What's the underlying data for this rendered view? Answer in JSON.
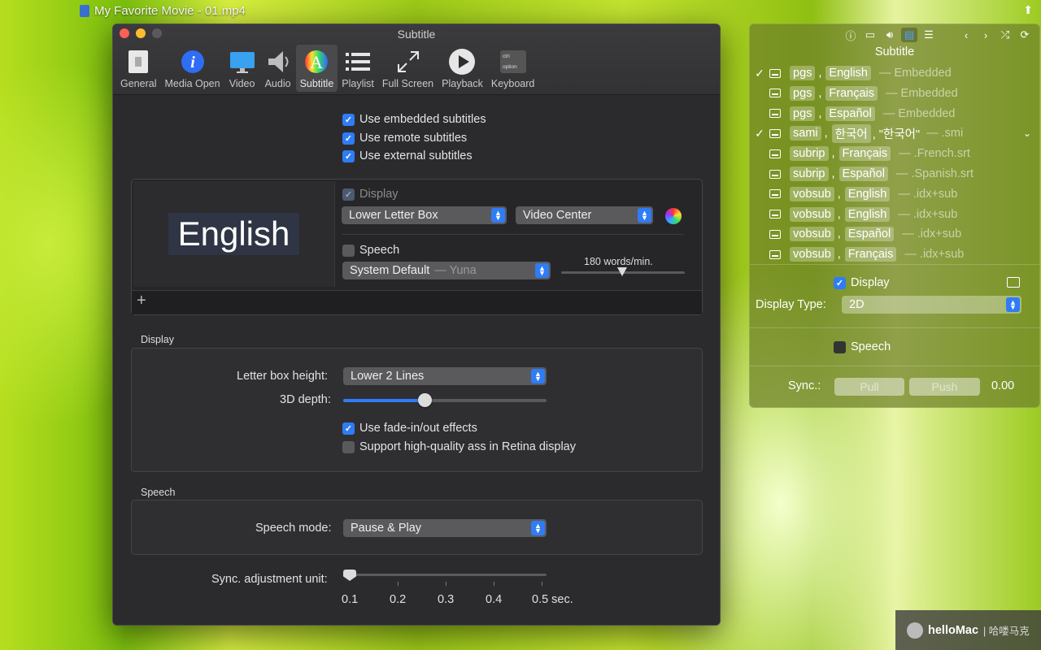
{
  "video": {
    "title": "My Favorite Movie - 01.mp4"
  },
  "prefs": {
    "window_title": "Subtitle",
    "toolbar": [
      {
        "label": "General",
        "icon": "general-icon"
      },
      {
        "label": "Media Open",
        "icon": "info-icon"
      },
      {
        "label": "Video",
        "icon": "monitor-icon"
      },
      {
        "label": "Audio",
        "icon": "speaker-icon"
      },
      {
        "label": "Subtitle",
        "icon": "subtitle-icon",
        "selected": true
      },
      {
        "label": "Playlist",
        "icon": "list-icon"
      },
      {
        "label": "Full Screen",
        "icon": "fullscreen-icon"
      },
      {
        "label": "Playback",
        "icon": "play-icon"
      },
      {
        "label": "Keyboard",
        "icon": "keyboard-icon"
      }
    ],
    "keyboard_keys": {
      "top": "ctrl",
      "bottom": "option"
    },
    "sources": [
      {
        "label": "Use embedded subtitles",
        "checked": true
      },
      {
        "label": "Use remote subtitles",
        "checked": true
      },
      {
        "label": "Use external subtitles",
        "checked": true
      }
    ],
    "preview": {
      "sample_text": "English",
      "display_label": "Display",
      "display_checked": true,
      "position": "Lower Letter Box",
      "alignment": "Video Center",
      "speech_label": "Speech",
      "speech_checked": false,
      "voice": "System Default",
      "voice_name": "— Yuna",
      "rate_label": "180 words/min.",
      "rate_fraction": 0.5,
      "add_label": "+"
    },
    "display_section": {
      "heading": "Display",
      "letter_box_label": "Letter box height:",
      "letter_box_value": "Lower 2 Lines",
      "depth_label": "3D depth:",
      "depth_fraction": 0.4,
      "fade_label": "Use fade-in/out effects",
      "fade_checked": true,
      "hq_label": "Support high-quality ass in Retina display",
      "hq_checked": false
    },
    "speech_section": {
      "heading": "Speech",
      "mode_label": "Speech mode:",
      "mode_value": "Pause & Play"
    },
    "sync": {
      "label": "Sync. adjustment unit:",
      "ticks": [
        "0.1",
        "0.2",
        "0.3",
        "0.4",
        "0.5 sec."
      ],
      "value": "0.1"
    }
  },
  "sidebar": {
    "title": "Subtitle",
    "tracks": [
      {
        "check": "",
        "codec": "pgs",
        "lang": "English",
        "extra": "",
        "src": "— Embedded"
      },
      {
        "check": "",
        "codec": "pgs",
        "lang": "Français",
        "extra": "",
        "src": "— Embedded"
      },
      {
        "check": "",
        "codec": "pgs",
        "lang": "Español",
        "extra": "",
        "src": "— Embedded"
      },
      {
        "check": "✓",
        "codec": "sami",
        "lang": "한국어",
        "extra": ", \"한국어\"",
        "src": "— .smi"
      },
      {
        "check": "",
        "codec": "subrip",
        "lang": "Français",
        "extra": "",
        "src": "— .French.srt"
      },
      {
        "check": "",
        "codec": "subrip",
        "lang": "Español",
        "extra": "",
        "src": "— .Spanish.srt"
      },
      {
        "check": "",
        "codec": "vobsub",
        "lang": "English",
        "extra": "",
        "src": "— .idx+sub"
      },
      {
        "check": "",
        "codec": "vobsub",
        "lang": "English",
        "extra": "",
        "src": "— .idx+sub"
      },
      {
        "check": "",
        "codec": "vobsub",
        "lang": "Español",
        "extra": "",
        "src": "— .idx+sub"
      },
      {
        "check": "",
        "codec": "vobsub",
        "lang": "Français",
        "extra": "",
        "src": "— .idx+sub"
      }
    ],
    "first_check": "✓",
    "display_label": "Display",
    "display_checked": true,
    "display_type_label": "Display Type:",
    "display_type_value": "2D",
    "speech_label": "Speech",
    "speech_checked": false,
    "sync_label": "Sync.:",
    "pull_label": "Pull",
    "push_label": "Push",
    "sync_value": "0.00"
  },
  "watermark": {
    "text": "helloMac",
    "suffix": "| 哈喽马克"
  }
}
